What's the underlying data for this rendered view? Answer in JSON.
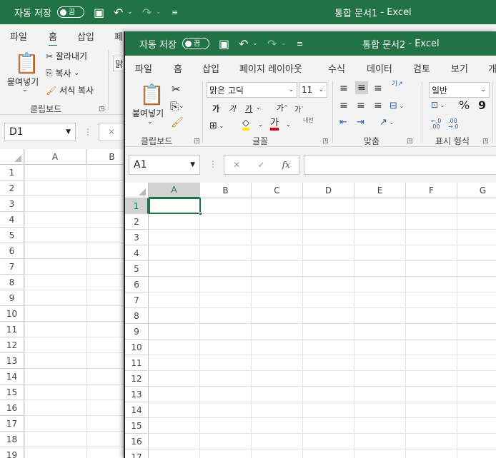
{
  "back_window": {
    "autosave_label": "자동 저장",
    "toggle_state": "끔",
    "title": "통합 문서1",
    "app": "Excel",
    "tabs": [
      "파일",
      "홈",
      "삽입",
      "페"
    ],
    "clipboard": {
      "paste": "붙여넣기",
      "cut": "잘라내기",
      "copy": "복사",
      "format_painter": "서식 복사",
      "group": "클립보드"
    },
    "font_partial": "맑",
    "namebox": "D1",
    "columns": [
      "A",
      "B"
    ],
    "rows": [
      "1",
      "2",
      "3",
      "4",
      "5",
      "6",
      "7",
      "8",
      "9",
      "10",
      "11",
      "12",
      "13",
      "14",
      "15",
      "16",
      "17",
      "18",
      "19"
    ]
  },
  "front_window": {
    "autosave_label": "자동 저장",
    "toggle_state": "끔",
    "title": "통합 문서2",
    "app": "Excel",
    "tabs": [
      "파일",
      "홈",
      "삽입",
      "페이지 레이아웃",
      "수식",
      "데이터",
      "검토",
      "보기",
      "개"
    ],
    "clipboard": {
      "paste": "붙여넣기",
      "group": "클립보드"
    },
    "font": {
      "name": "맑은 고딕",
      "size": "11",
      "bold": "가",
      "italic": "가",
      "underline": "가",
      "grow": "가",
      "shrink": "가",
      "group": "글꼴"
    },
    "align": {
      "wrap": "내천",
      "group": "맞춤"
    },
    "number": {
      "format": "일반",
      "group": "표시 형식",
      "percent": "%",
      "comma": "9"
    },
    "namebox": "A1",
    "fx": "fx",
    "columns": [
      "A",
      "B",
      "C",
      "D",
      "E",
      "F",
      "G"
    ],
    "rows": [
      "1",
      "2",
      "3",
      "4",
      "5",
      "6",
      "7",
      "8",
      "9",
      "10",
      "11",
      "12",
      "13",
      "14",
      "15",
      "16",
      "17"
    ]
  },
  "colors": {
    "excel_green": "#217346",
    "ribbon_bg": "#f3f3f3",
    "grid_line": "#e2e2e2",
    "selected_header": "#d2d2d2"
  }
}
